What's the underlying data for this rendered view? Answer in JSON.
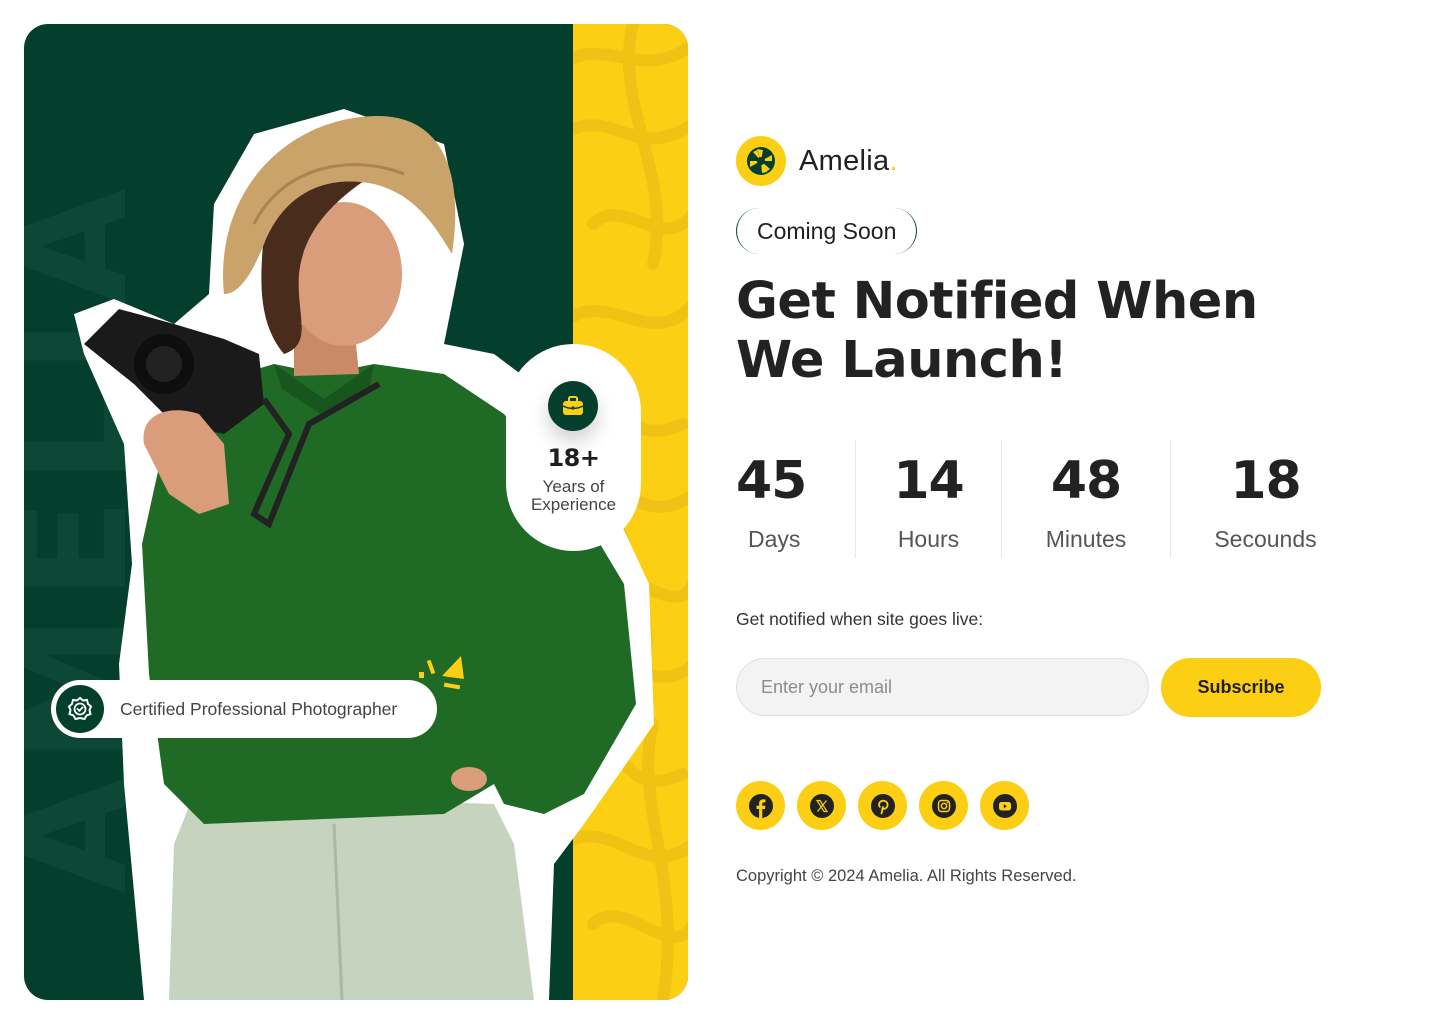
{
  "brand": {
    "name": "Amelia",
    "dot": ".",
    "watermark": "AMELIA",
    "colors": {
      "green": "#033f2c",
      "yellow": "#fccf15",
      "text": "#222222"
    }
  },
  "hero": {
    "experience_badge": {
      "icon": "briefcase-icon",
      "value": "18+",
      "label_line1": "Years of",
      "label_line2": "Experience"
    },
    "certificate_badge": {
      "icon": "verified-badge-icon",
      "label": "Certified Professional Photographer"
    },
    "photo_alt": "Woman in straw hat and green sweater holding a camera"
  },
  "status_pill": "Coming Soon",
  "headline": {
    "line1": "Get Notified When",
    "line2": "We Launch!"
  },
  "countdown": [
    {
      "value": "45",
      "label": "Days"
    },
    {
      "value": "14",
      "label": "Hours"
    },
    {
      "value": "48",
      "label": "Minutes"
    },
    {
      "value": "18",
      "label": "Secounds"
    }
  ],
  "subscribe": {
    "prompt": "Get notified when site goes live:",
    "email_value": "",
    "email_placeholder": "Enter your email",
    "button_label": "Subscribe"
  },
  "socials": [
    {
      "name": "facebook",
      "icon": "facebook-icon"
    },
    {
      "name": "x",
      "icon": "x-icon"
    },
    {
      "name": "pinterest",
      "icon": "pinterest-icon"
    },
    {
      "name": "instagram",
      "icon": "instagram-icon"
    },
    {
      "name": "youtube",
      "icon": "youtube-icon"
    }
  ],
  "footer": {
    "copyright": "Copyright © 2024 Amelia. All Rights Reserved."
  }
}
